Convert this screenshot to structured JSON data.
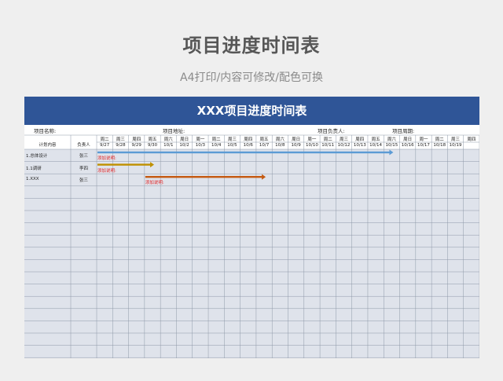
{
  "page": {
    "title": "项目进度时间表",
    "subtitle": "A4打印/内容可修改/配色可换"
  },
  "sheet": {
    "banner": "XXX项目进度时间表",
    "info": {
      "project_name": "项目名称:",
      "project_address": "项目地址:",
      "project_manager": "项目负责人:",
      "project_period": "项目周期:"
    },
    "headers": {
      "plan": "计划内容",
      "owner": "负责人"
    },
    "weekdays": [
      "周二",
      "周三",
      "周四",
      "周五",
      "周六",
      "周日",
      "周一",
      "周二",
      "周三",
      "周四",
      "周五",
      "周六",
      "周日",
      "周一",
      "周二",
      "周三",
      "周四",
      "周五",
      "周六",
      "周日",
      "周一",
      "周二",
      "周三",
      "周四"
    ],
    "dates": [
      "9/27",
      "9/28",
      "9/29",
      "9/30",
      "10/1",
      "10/2",
      "10/3",
      "10/4",
      "10/5",
      "10/6",
      "10/7",
      "10/8",
      "10/9",
      "10/10",
      "10/11",
      "10/12",
      "10/13",
      "10/14",
      "10/15",
      "10/16",
      "10/17",
      "10/18",
      "10/19"
    ],
    "tasks": [
      {
        "name": "1.总体设计",
        "owner": "张三",
        "note": "添加说明:",
        "start": 0,
        "end": 18,
        "color": "#5b9bd5"
      },
      {
        "name": "1.1调研",
        "owner": "李四",
        "note": "添加说明:",
        "start": 0,
        "end": 3,
        "color": "#bf9000"
      },
      {
        "name": "1.XXX",
        "owner": "张三",
        "note": "添加说明:",
        "start": 3,
        "end": 10,
        "color": "#c55a11"
      }
    ],
    "colors": {
      "banner": "#2f5597",
      "grid_fill": "#dfe3eb",
      "grid_line": "#8e98a8",
      "note_text": "#e02020"
    }
  }
}
